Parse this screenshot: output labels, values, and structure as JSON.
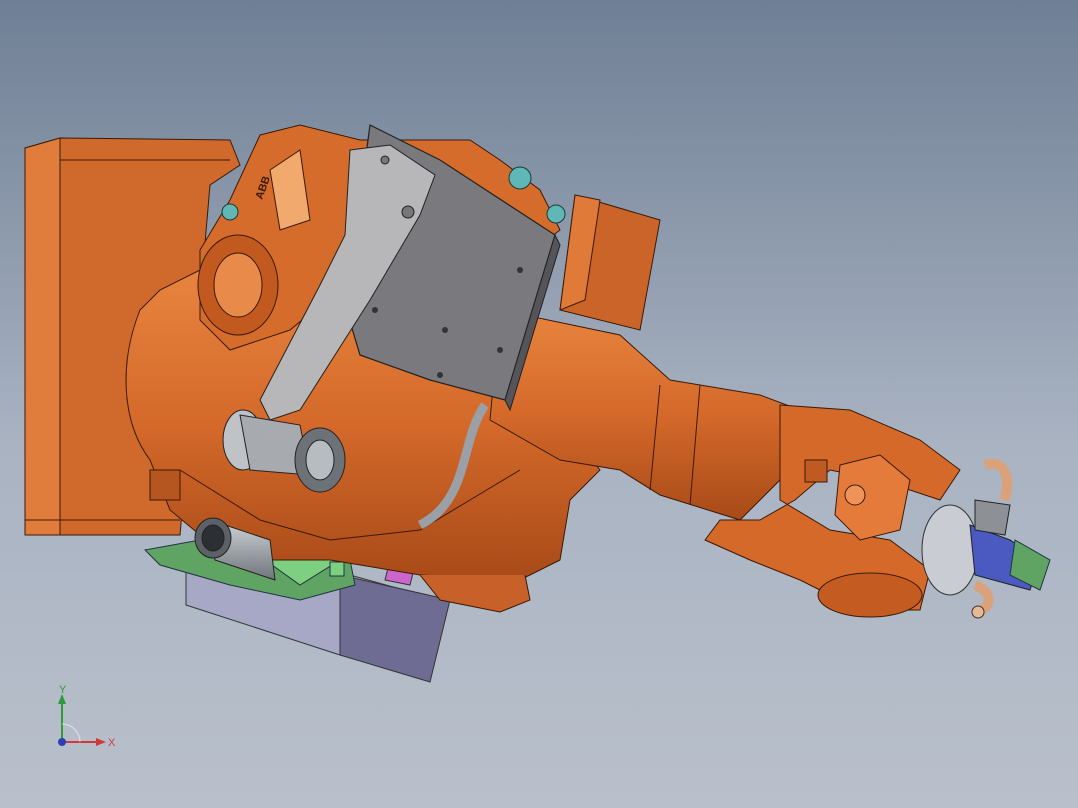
{
  "viewport": {
    "background_top": "#6f7f95",
    "background_mid": "#a9b3c2",
    "background_bottom": "#b9c0cb"
  },
  "model": {
    "robot_color": "#d4692a",
    "robot_shadow": "#a84a18",
    "robot_highlight": "#e8843f",
    "plate_color": "#7a7a7e",
    "bracket_color": "#b7b7b9",
    "base_block_color": "#a6a8c6",
    "base_dark_color": "#6e6c93",
    "green_color": "#5fa463",
    "teal_color": "#5fb7b6",
    "tube_color": "#9aa0a6",
    "pipe_color": "#d9a27a",
    "magenta_color": "#cc66cc"
  },
  "triad": {
    "y_label": "Y",
    "x_label": "X",
    "y_color": "#2e9a3c",
    "x_color": "#d23a3a",
    "z_color": "#2c3fb3"
  }
}
